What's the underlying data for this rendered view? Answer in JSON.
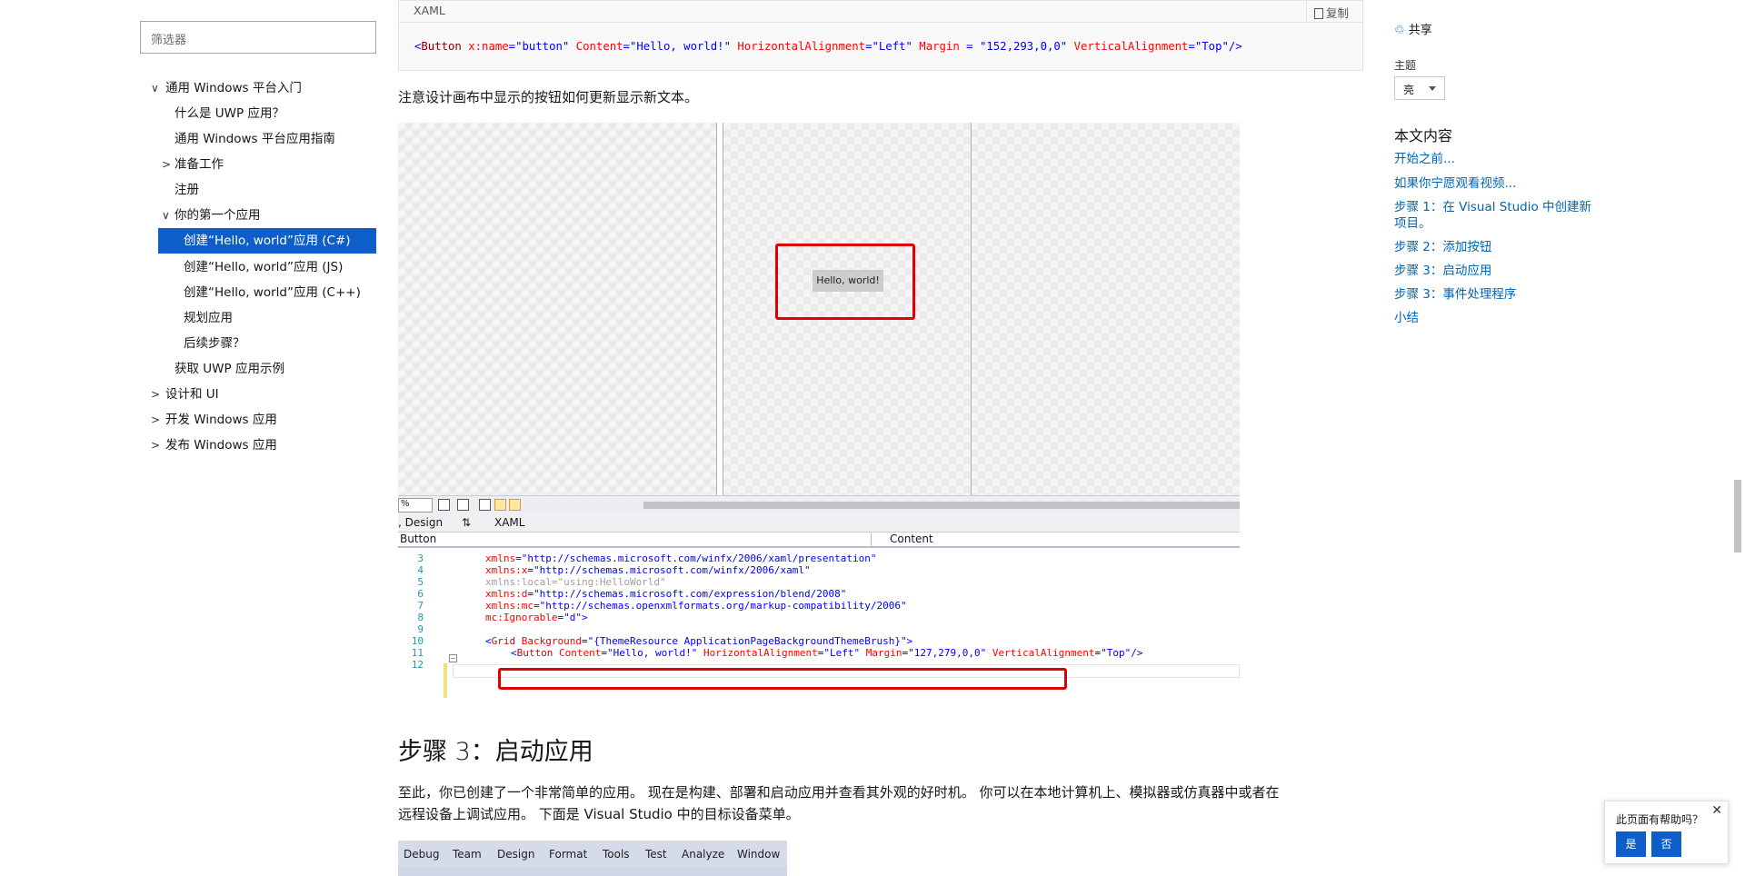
{
  "toc": {
    "filter_placeholder": "筛选器",
    "items": [
      {
        "label": "通用 Windows 平台入门",
        "chev": "∨"
      },
      {
        "label": "什么是 UWP 应用？"
      },
      {
        "label": "通用 Windows 平台应用指南"
      },
      {
        "label": "准备工作",
        "chev": ">"
      },
      {
        "label": "注册"
      },
      {
        "label": "你的第一个应用",
        "chev": "∨"
      },
      {
        "label": "创建“Hello, world”应用 (C#)"
      },
      {
        "label": "创建“Hello, world”应用 (JS)"
      },
      {
        "label": "创建“Hello, world”应用 (C++)"
      },
      {
        "label": "规划应用"
      },
      {
        "label": "后续步骤？"
      },
      {
        "label": "获取 UWP 应用示例"
      },
      {
        "label": "设计和 UI",
        "chev": ">"
      },
      {
        "label": "开发 Windows 应用",
        "chev": ">"
      },
      {
        "label": "发布 Windows 应用",
        "chev": ">"
      }
    ]
  },
  "codeblock": {
    "lang": "XAML",
    "copy_label": "复制",
    "tokens": [
      "<",
      "Button",
      " x:name",
      "=",
      "\"button\"",
      " Content",
      "=",
      "\"Hello, world!\"",
      " HorizontalAlignment",
      "=",
      "\"Left\"",
      " Margin",
      " = ",
      "\"152,293,0,0\"",
      " VerticalAlignment",
      "=",
      "\"Top\"",
      "/>"
    ]
  },
  "intro_text": "注意设计画布中显示的按钮如何更新显示新文本。",
  "designer": {
    "button_text": "Hello, world!",
    "zoom_value": "%",
    "design_tab": ", Design",
    "swap_icon": "⇅",
    "xaml_tab": "XAML",
    "element_dropdown": "Button",
    "property_dropdown": "Content",
    "lines": [
      {
        "no": "3",
        "parts": [
          [
            "xa",
            "xmlns"
          ],
          [
            "",
            "="
          ],
          [
            "xs",
            "\"http://schemas.microsoft.com/winfx/2006/xaml/presentation\""
          ]
        ]
      },
      {
        "no": "4",
        "parts": [
          [
            "xa",
            "xmlns:x"
          ],
          [
            "",
            "="
          ],
          [
            "xs",
            "\"http://schemas.microsoft.com/winfx/2006/xaml\""
          ]
        ]
      },
      {
        "no": "5",
        "parts": [
          [
            "xg",
            "xmlns:local=\"using:HelloWorld\""
          ]
        ]
      },
      {
        "no": "6",
        "parts": [
          [
            "xa",
            "xmlns:d"
          ],
          [
            "",
            "="
          ],
          [
            "xs",
            "\"http://schemas.microsoft.com/expression/blend/2008\""
          ]
        ]
      },
      {
        "no": "7",
        "parts": [
          [
            "xa",
            "xmlns:mc"
          ],
          [
            "",
            "="
          ],
          [
            "xs",
            "\"http://schemas.openxmlformats.org/markup-compatibility/2006\""
          ]
        ]
      },
      {
        "no": "8",
        "parts": [
          [
            "xa",
            "mc:Ignorable"
          ],
          [
            "",
            "="
          ],
          [
            "xs",
            "\"d\""
          ],
          [
            "xs",
            ">"
          ]
        ]
      },
      {
        "no": "9",
        "parts": []
      },
      {
        "no": "10",
        "parts": [
          [
            "xs",
            "<"
          ],
          [
            "xk",
            "Grid"
          ],
          [
            "xa",
            " Background"
          ],
          [
            "",
            "="
          ],
          [
            "xs",
            "\"{ThemeResource ApplicationPageBackgroundThemeBrush}\""
          ],
          [
            "xs",
            ">"
          ]
        ]
      },
      {
        "no": "11",
        "parts": [
          [
            "xs",
            "<"
          ],
          [
            "xk",
            "Button"
          ],
          [
            "xa",
            " Content"
          ],
          [
            "",
            "="
          ],
          [
            "xs",
            "\"Hello, world!\""
          ],
          [
            "xa",
            " HorizontalAlignment"
          ],
          [
            "",
            "="
          ],
          [
            "xs",
            "\"Left\""
          ],
          [
            "xa",
            " Margin"
          ],
          [
            "",
            "="
          ],
          [
            "xs",
            "\"127,279,0,0\""
          ],
          [
            "xa",
            " VerticalAlignment"
          ],
          [
            "",
            "="
          ],
          [
            "xs",
            "\"Top\""
          ],
          [
            "xs",
            "/>"
          ]
        ]
      },
      {
        "no": "12",
        "parts": []
      }
    ]
  },
  "step3": {
    "heading": "步骤 3：启动应用",
    "line1": "至此，你已创建了一个非常简单的应用。 现在是构建、部署和启动应用并查看其外观的好时机。 你可以在本地计算机上、模拟器或仿真器中或者在",
    "line2": "远程设备上调试应用。 下面是 Visual Studio 中的目标设备菜单。"
  },
  "vs_menu": [
    "Debug",
    "Team",
    "Design",
    "Format",
    "Tools",
    "Test",
    "Analyze",
    "Window"
  ],
  "rail": {
    "share": "共享",
    "theme_label": "主题",
    "theme_value": "亮",
    "in_this_article": "本文内容",
    "links": [
      "开始之前...",
      "如果你宁愿观看视频...",
      "步骤 1：在 Visual Studio 中创建新",
      "项目。",
      "步骤 2：添加按钮",
      "步骤 3：启动应用",
      "步骤 3：事件处理程序",
      "小结"
    ]
  },
  "feedback": {
    "question": "此页面有帮助吗？",
    "yes": "是",
    "no": "否",
    "close": "✕"
  }
}
